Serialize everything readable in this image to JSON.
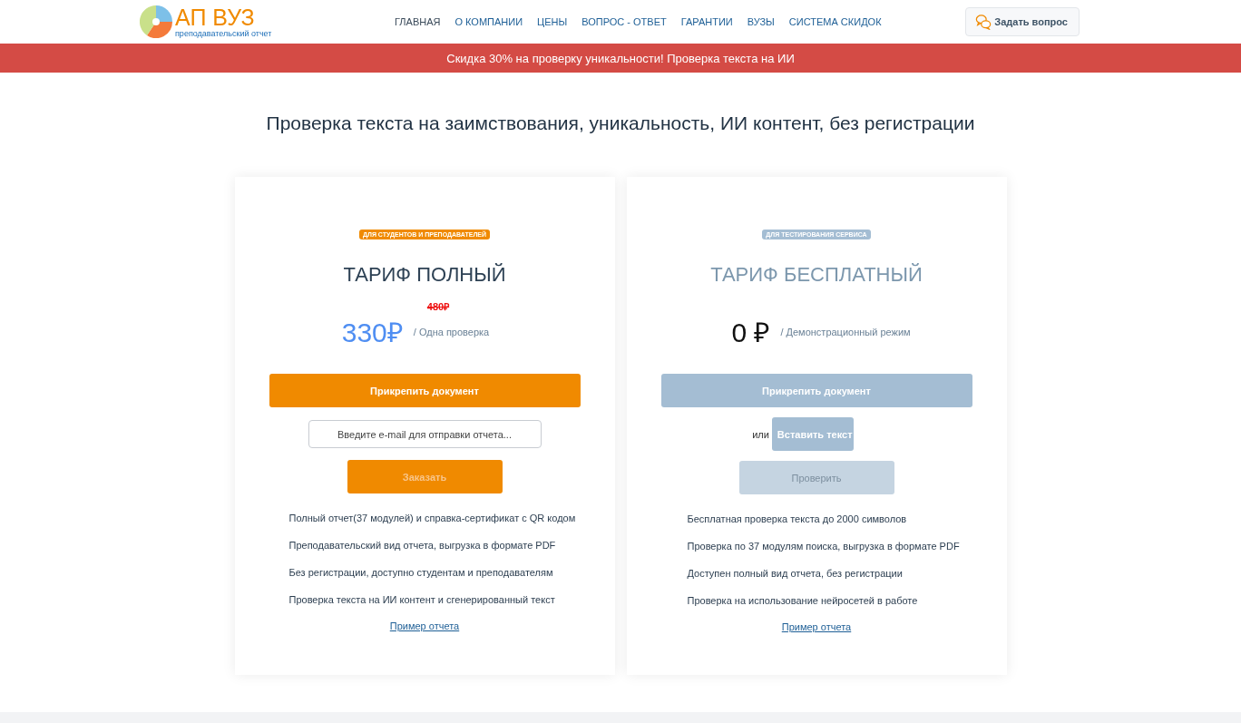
{
  "header": {
    "logo": {
      "title": "АП ВУЗ",
      "subtitle": "преподавательский отчет"
    },
    "nav": [
      {
        "label": "ГЛАВНАЯ",
        "selected": true
      },
      {
        "label": "О КОМПАНИИ",
        "selected": false
      },
      {
        "label": "ЦЕНЫ",
        "selected": false
      },
      {
        "label": "ВОПРОС - ОТВЕТ",
        "selected": false
      },
      {
        "label": "ГАРАНТИИ",
        "selected": false
      },
      {
        "label": "ВУЗЫ",
        "selected": false
      },
      {
        "label": "СИСТЕМА СКИДОК",
        "selected": false
      }
    ],
    "ask_button": "Задать вопрос"
  },
  "promo_banner": "Скидка 30% на проверку уникальности! Проверка текста на ИИ",
  "heading": "Проверка текста на заимствования, уникальность, ИИ контент, без регистрации",
  "cards": [
    {
      "kind": "full",
      "badge": "ДЛЯ СТУДЕНТОВ И ПРЕПОДАВАТЕЛЕЙ",
      "title": "ТАРИФ ПОЛНЫЙ",
      "old_price": "480₽",
      "price": "330₽",
      "price_note": "/ Одна проверка",
      "attach_button": "Прикрепить документ",
      "email": {
        "placeholder": "Введите e-mail для отправки отчета..."
      },
      "order_button": "Заказать",
      "features": [
        "Полный отчет(37 модулей) и справка-сертификат с QR кодом",
        "Преподавательский вид отчета, выгрузка в формате PDF",
        "Без регистрации, доступно студентам и преподавателям",
        "Проверка текста на ИИ контент и сгенерированный текст"
      ],
      "sample_link": "Пример отчета"
    },
    {
      "kind": "free",
      "badge": "ДЛЯ ТЕСТИРОВАНИЯ СЕРВИСА",
      "title": "ТАРИФ БЕСПЛАТНЫЙ",
      "price": "0 ₽",
      "price_note": "/ Демонстрационный режим",
      "attach_button": "Прикрепить документ",
      "or_label": "или",
      "paste_button": "Вставить текст",
      "check_button": "Проверить",
      "features": [
        "Бесплатная проверка текста до 2000 символов",
        "Проверка по 37 модулям поиска, выгрузка в формате PDF",
        "Доступен полный вид отчета, без регистрации",
        "Проверка на использование нейросетей в работе"
      ],
      "sample_link": "Пример отчета"
    }
  ]
}
